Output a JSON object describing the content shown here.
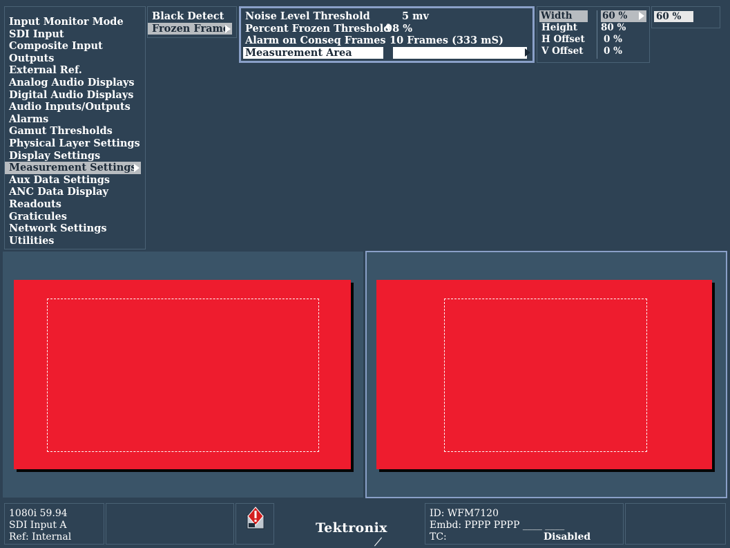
{
  "main_menu": {
    "items": [
      "Input Monitor Mode",
      "SDI Input",
      "Composite Input",
      "Outputs",
      "External Ref.",
      "Analog Audio Displays",
      "Digital Audio Displays",
      "Audio Inputs/Outputs",
      "Alarms",
      "Gamut Thresholds",
      "Physical Layer Settings",
      "Display Settings",
      "Measurement Settings",
      "Aux Data Settings",
      "ANC Data Display",
      "Readouts",
      "Graticules",
      "Network Settings",
      "Utilities"
    ],
    "selected": "Measurement Settings"
  },
  "sub_menu": {
    "items": [
      "Black Detect",
      "Frozen Frame"
    ],
    "selected": "Frozen Frame"
  },
  "frozen_frame_settings": {
    "rows": [
      {
        "label": "Noise Level Threshold",
        "value": "5 mv"
      },
      {
        "label": "Percent Frozen Threshold",
        "value": "98 %"
      },
      {
        "label": "Alarm on Conseq Frames",
        "value": "10 Frames (333 mS)"
      },
      {
        "label": "Measurement Area",
        "value": ""
      }
    ],
    "selected": "Measurement Area"
  },
  "measurement_area": {
    "rows": [
      {
        "label": "Width",
        "value": "60 %"
      },
      {
        "label": "Height",
        "value": "80 %"
      },
      {
        "label": "H Offset",
        "value": "0 %"
      },
      {
        "label": "V Offset",
        "value": "0 %"
      }
    ],
    "selected": "Width"
  },
  "edit_value": "60 %",
  "status_bar": {
    "format": "1080i 59.94",
    "input": "SDI Input A",
    "ref": "Ref: Internal",
    "brand": "Tektronix",
    "id": "ID: WFM7120",
    "embd": "Embd: PPPP PPPP ____ ____",
    "tc_label": "TC:",
    "tc_value": "Disabled"
  },
  "colors": {
    "background": "#2e4254",
    "tile_background": "#3a5468",
    "selected_highlight": "#b8bcc0",
    "picture_red": "#ee1c2e",
    "active_tile_border": "#8aa0c8"
  }
}
